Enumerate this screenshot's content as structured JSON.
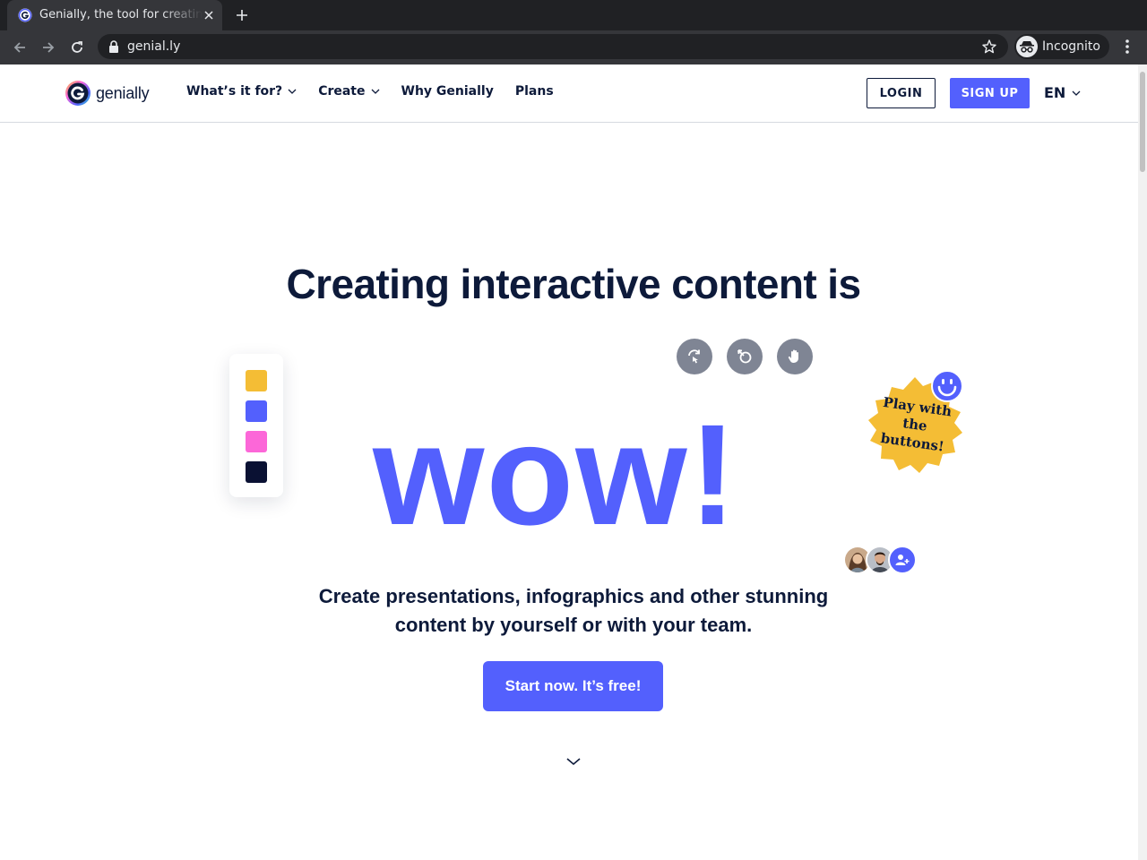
{
  "browser": {
    "tab_title": "Genially, the tool for creating interactive content",
    "url": "genial.ly",
    "profile_label": "Incognito"
  },
  "header": {
    "logo_text": "genially",
    "nav": [
      {
        "label": "What’s it for?",
        "has_dropdown": true
      },
      {
        "label": "Create",
        "has_dropdown": true
      },
      {
        "label": "Why Genially",
        "has_dropdown": false
      },
      {
        "label": "Plans",
        "has_dropdown": false
      }
    ],
    "login_label": "LOGIN",
    "signup_label": "SIGN UP",
    "language": "EN"
  },
  "hero": {
    "headline": "Creating interactive content is",
    "wow_text": "wow!",
    "palette_colors": [
      "#f4bd35",
      "#5360fd",
      "#fc67d8",
      "#0a1133"
    ],
    "tools": [
      "rotate-icon",
      "pointer-icon",
      "hand-icon"
    ],
    "badge_text": "Play with the buttons!",
    "subtitle": "Create presentations, infographics and other stunning content by yourself or with your team.",
    "cta_label": "Start now. It’s free!"
  },
  "colors": {
    "brand": "#5360fd",
    "navy": "#0d1a3a",
    "badge_yellow": "#f4bd35"
  }
}
